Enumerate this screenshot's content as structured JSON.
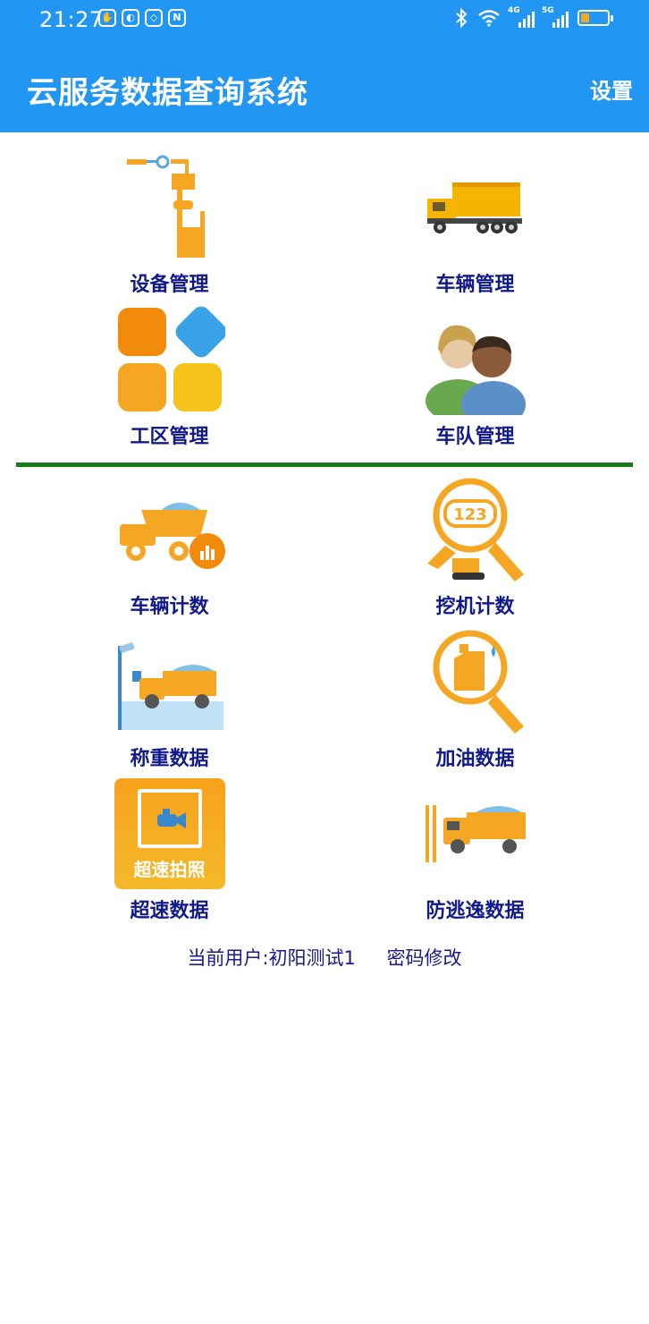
{
  "status_bar": {
    "time": "21:27",
    "net_4g": "4G",
    "net_5g": "5G"
  },
  "header": {
    "title": "云服务数据查询系统",
    "settings_label": "设置"
  },
  "management": [
    {
      "label": "设备管理",
      "icon": "equipment-pole-icon"
    },
    {
      "label": "车辆管理",
      "icon": "dump-truck-icon"
    },
    {
      "label": "工区管理",
      "icon": "workzone-tiles-icon"
    },
    {
      "label": "车队管理",
      "icon": "fleet-people-icon"
    }
  ],
  "data": [
    {
      "label": "车辆计数",
      "icon": "truck-count-icon"
    },
    {
      "label": "挖机计数",
      "icon": "excavator-count-icon"
    },
    {
      "label": "称重数据",
      "icon": "weighing-icon"
    },
    {
      "label": "加油数据",
      "icon": "fuel-search-icon"
    },
    {
      "label": "超速数据",
      "icon": "speed-photo-icon",
      "icon_text": "超速拍照"
    },
    {
      "label": "防逃逸数据",
      "icon": "anti-escape-icon"
    }
  ],
  "footer": {
    "current_user": "当前用户:初阳测试1",
    "password_change": "密码修改"
  },
  "colors": {
    "appbar": "#2196F3",
    "label": "#111a8a",
    "divider": "#1a7a1a",
    "accent": "#f5a623"
  }
}
